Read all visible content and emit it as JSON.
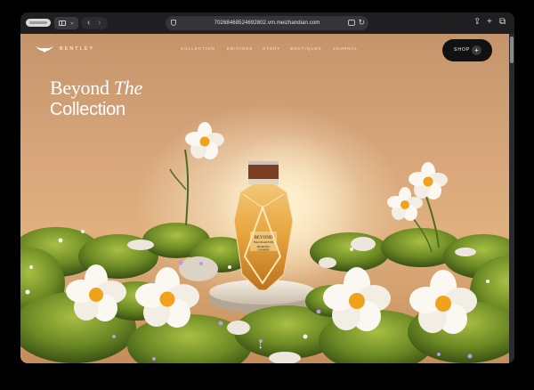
{
  "browser": {
    "url": "70268468524692802.vm.meizhandian.com"
  },
  "site": {
    "brand": "BENTLEY",
    "nav": [
      "COLLECTION",
      "EDITIONS",
      "STORY",
      "BOUTIQUES",
      "JOURNAL"
    ],
    "shop_label": "SHOP",
    "shop_plus": "+",
    "headline_word1": "Beyond",
    "headline_word2": "The",
    "headline_line2": "Collection",
    "scroll_arrow": "↓"
  },
  "product": {
    "bottle_name": "BEYOND",
    "bottle_sub": "THE COLLECTION",
    "bottle_variant": "MAJESTIC",
    "bottle_variant_sub": "CASHMERE"
  },
  "colors": {
    "background_top": "#c6946a",
    "background_glow": "#ffecbe",
    "moss": "#6c8a24",
    "flower_center": "#f1a21c",
    "bottle_amber": "#e6a33c",
    "cap": "#7a3e22"
  }
}
